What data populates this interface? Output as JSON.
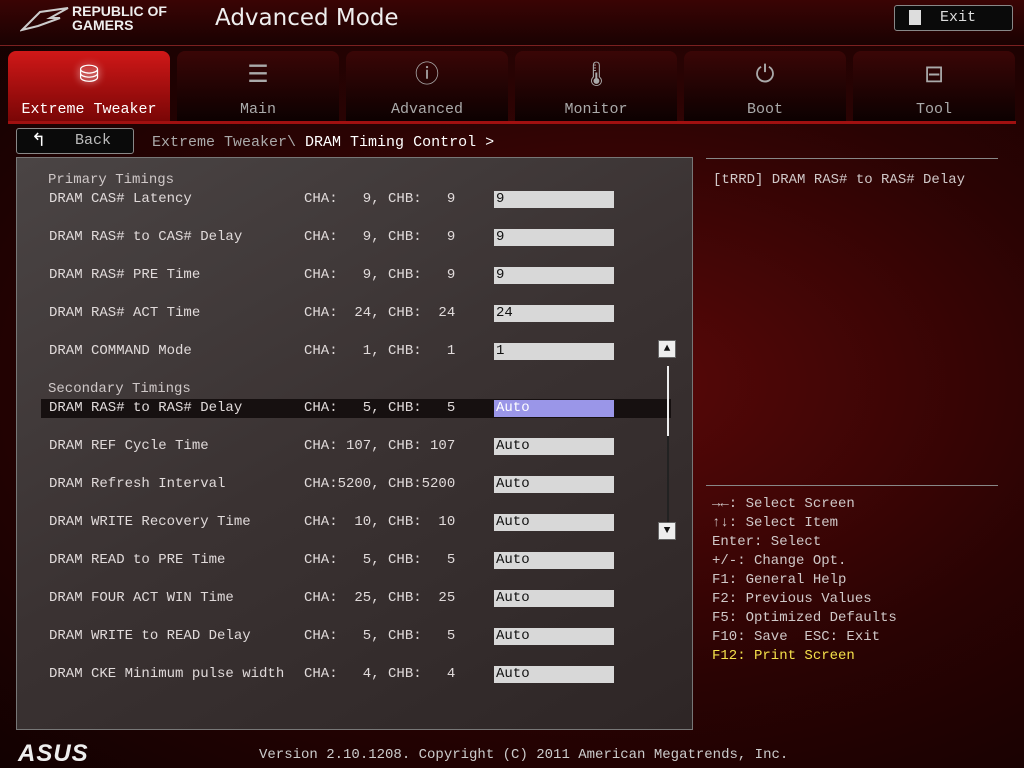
{
  "header": {
    "brand_line1": "REPUBLIC OF",
    "brand_line2": "GAMERS",
    "title": "Advanced Mode",
    "exit_label": "Exit"
  },
  "tabs": [
    {
      "label": "Extreme Tweaker",
      "icon": "tweaker-icon"
    },
    {
      "label": "Main",
      "icon": "list-icon"
    },
    {
      "label": "Advanced",
      "icon": "advanced-info-icon"
    },
    {
      "label": "Monitor",
      "icon": "thermometer-icon"
    },
    {
      "label": "Boot",
      "icon": "power-icon"
    },
    {
      "label": "Tool",
      "icon": "toolbox-icon"
    }
  ],
  "nav": {
    "back_label": "Back",
    "crumb_parent": "Extreme Tweaker\\",
    "crumb_current": "DRAM Timing Control >"
  },
  "sections": {
    "primary": "Primary Timings",
    "secondary": "Secondary Timings"
  },
  "primary_rows": [
    {
      "label": "DRAM CAS# Latency",
      "channels": "CHA:   9, CHB:   9",
      "value": "9"
    },
    {
      "label": "DRAM RAS# to CAS# Delay",
      "channels": "CHA:   9, CHB:   9",
      "value": "9"
    },
    {
      "label": "DRAM RAS# PRE Time",
      "channels": "CHA:   9, CHB:   9",
      "value": "9"
    },
    {
      "label": "DRAM RAS# ACT Time",
      "channels": "CHA:  24, CHB:  24",
      "value": "24"
    },
    {
      "label": "DRAM COMMAND Mode",
      "channels": "CHA:   1, CHB:   1",
      "value": "1"
    }
  ],
  "secondary_rows": [
    {
      "label": "DRAM RAS# to RAS# Delay",
      "channels": "CHA:   5, CHB:   5",
      "value": "Auto"
    },
    {
      "label": "DRAM REF Cycle Time",
      "channels": "CHA: 107, CHB: 107",
      "value": "Auto"
    },
    {
      "label": "DRAM Refresh Interval",
      "channels": "CHA:5200, CHB:5200",
      "value": "Auto"
    },
    {
      "label": "DRAM WRITE Recovery Time",
      "channels": "CHA:  10, CHB:  10",
      "value": "Auto"
    },
    {
      "label": "DRAM READ to PRE Time",
      "channels": "CHA:   5, CHB:   5",
      "value": "Auto"
    },
    {
      "label": "DRAM FOUR ACT WIN Time",
      "channels": "CHA:  25, CHB:  25",
      "value": "Auto"
    },
    {
      "label": "DRAM WRITE to READ Delay",
      "channels": "CHA:   5, CHB:   5",
      "value": "Auto"
    },
    {
      "label": "DRAM CKE Minimum pulse width",
      "channels": "CHA:   4, CHB:   4",
      "value": "Auto"
    }
  ],
  "help_text": "[tRRD] DRAM RAS# to RAS# Delay",
  "keys": [
    "→←: Select Screen",
    "↑↓: Select Item",
    "Enter: Select",
    "+/-: Change Opt.",
    "F1: General Help",
    "F2: Previous Values",
    "F5: Optimized Defaults",
    "F10: Save  ESC: Exit"
  ],
  "key_highlight": "F12: Print Screen",
  "footer": {
    "logo": "ASUS",
    "version": "Version 2.10.1208. Copyright (C) 2011 American Megatrends, Inc."
  },
  "colors": {
    "accent": "#d01818",
    "selected": "#9a96e8",
    "highlight_key": "#f5e04a"
  }
}
